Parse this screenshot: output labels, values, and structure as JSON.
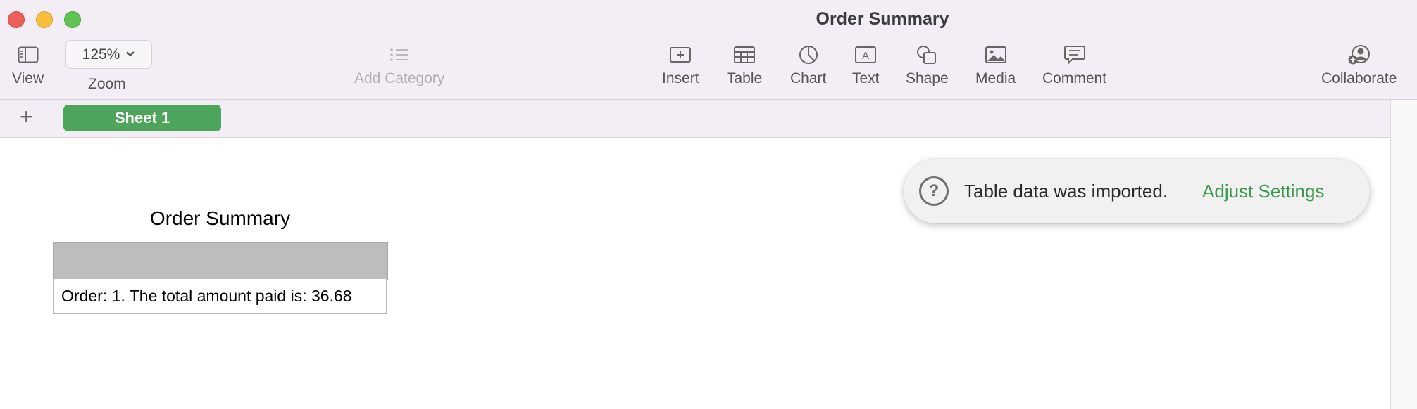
{
  "window": {
    "title": "Order Summary"
  },
  "toolbar": {
    "view_label": "View",
    "zoom_value": "125%",
    "zoom_label": "Zoom",
    "add_category_label": "Add Category",
    "insert_label": "Insert",
    "table_label": "Table",
    "chart_label": "Chart",
    "text_label": "Text",
    "shape_label": "Shape",
    "media_label": "Media",
    "comment_label": "Comment",
    "collaborate_label": "Collaborate"
  },
  "sheets": {
    "add_symbol": "+",
    "active_tab": "Sheet 1"
  },
  "table": {
    "title": "Order Summary",
    "cell_text": "Order: 1. The total amount paid is: 36.68"
  },
  "notification": {
    "message": "Table data was imported.",
    "action": "Adjust Settings",
    "icon_glyph": "?"
  },
  "colors": {
    "accent_green": "#4ca55a",
    "link_green": "#3a9a4a",
    "toolbar_bg": "#f3eef5"
  }
}
